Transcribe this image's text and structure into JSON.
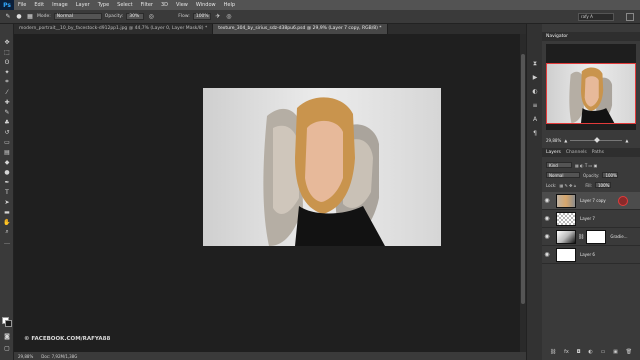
{
  "app": {
    "logo": "Ps"
  },
  "menu": [
    "File",
    "Edit",
    "Image",
    "Layer",
    "Type",
    "Select",
    "Filter",
    "3D",
    "View",
    "Window",
    "Help"
  ],
  "options": {
    "mode_label": "Mode:",
    "mode_value": "Normal",
    "opacity_label": "Opacity:",
    "opacity_value": "30%",
    "flow_label": "Flow:",
    "flow_value": "100%",
    "workspace_value": "rafy A"
  },
  "tabs": [
    {
      "label": "modern_portrait__10_by_facestock-d912pp1.jpg @ 44,7% (Layer 0, Layer Mask/8) *"
    },
    {
      "label": "texture_304_by_sirius_sdz-d38pu6.psd @ 29,9% (Layer 7 copy, RGB/8) *"
    }
  ],
  "canvas": {
    "watermark": "© FACEBOOK.COM/RAFYA88"
  },
  "status": {
    "zoom": "29,88%",
    "doc": "Doc: 7,92M/1,38G"
  },
  "navigator": {
    "tabs": [
      "Navigator"
    ],
    "zoom": "29,88%"
  },
  "layers_panel": {
    "tabs": [
      "Layers",
      "Channels",
      "Paths"
    ],
    "kind_label": "Kind",
    "blend_mode": "Normal",
    "opacity_label": "Opacity:",
    "opacity_value": "100%",
    "lock_label": "Lock:",
    "fill_label": "Fill:",
    "fill_value": "100%",
    "layers": [
      {
        "name": "Layer 7 copy",
        "thumb": "photo",
        "selected": true
      },
      {
        "name": "Layer 7",
        "thumb": "checker",
        "selected": false
      },
      {
        "name": "Gradie...",
        "thumb": "grad",
        "selected": false,
        "mask": true
      },
      {
        "name": "Layer 6",
        "thumb": "white",
        "selected": false
      }
    ]
  },
  "colors": {
    "accent": "#e23b3b",
    "panel": "#3a3a3a",
    "canvas_bg": "#1f1f1f"
  }
}
